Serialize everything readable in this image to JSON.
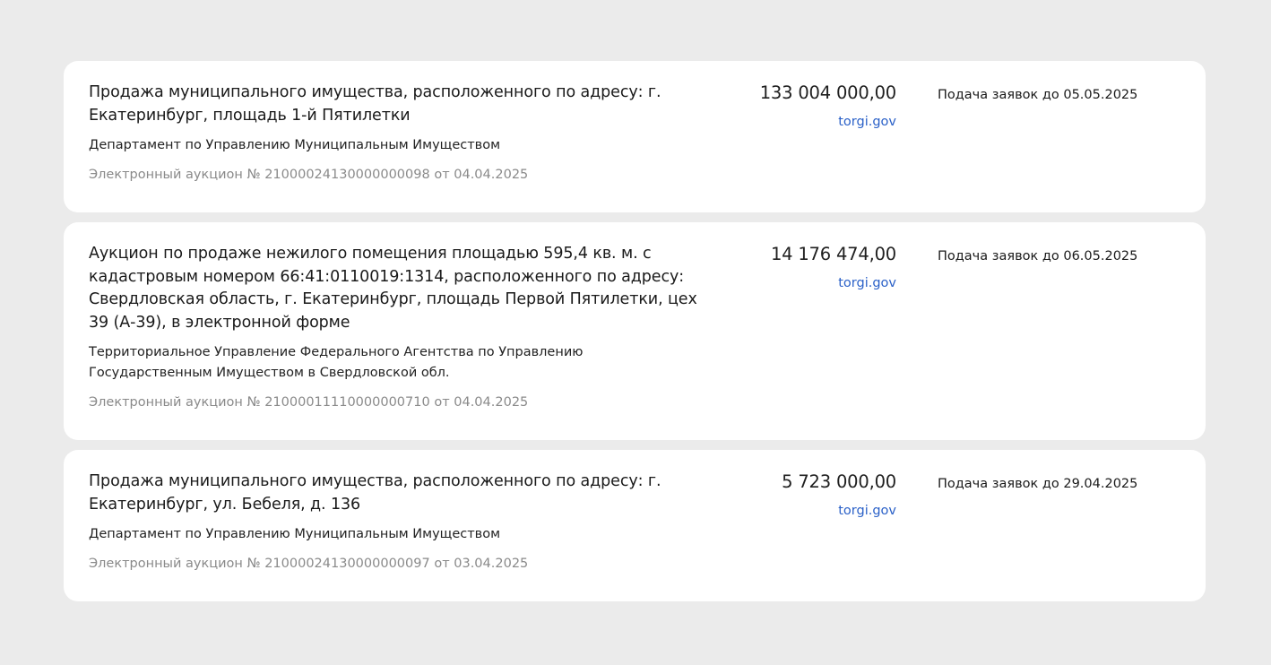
{
  "listings": [
    {
      "title": "Продажа муниципального имущества, расположенного по адресу: г. Екатеринбург, площадь 1-й Пятилетки",
      "organizer": "Департамент по Управлению Муниципальным Имуществом",
      "procedure": "Электронный аукцион № 21000024130000000098 от 04.04.2025",
      "price": "133 004 000,00",
      "source": "torgi.gov",
      "deadline": "Подача заявок до 05.05.2025"
    },
    {
      "title": "Аукцион по продаже нежилого помещения площадью 595,4 кв. м. с кадастровым номером 66:41:0110019:1314, расположенного по адресу: Свердловская область, г. Екатеринбург, площадь Первой Пятилетки, цех 39 (А-39), в электронной форме",
      "organizer": "Территориальное Управление Федерального Агентства по Управлению Государственным Имуществом в Свердловской обл.",
      "procedure": "Электронный аукцион № 21000011110000000710 от 04.04.2025",
      "price": "14 176 474,00",
      "source": "torgi.gov",
      "deadline": "Подача заявок до 06.05.2025"
    },
    {
      "title": "Продажа муниципального имущества, расположенного по адресу: г. Екатеринбург, ул. Бебеля, д. 136",
      "organizer": "Департамент по Управлению Муниципальным Имуществом",
      "procedure": "Электронный аукцион № 21000024130000000097 от 03.04.2025",
      "price": "5 723 000,00",
      "source": "torgi.gov",
      "deadline": "Подача заявок до 29.04.2025"
    }
  ],
  "colors": {
    "page_background": "#ebebeb",
    "card_background": "#ffffff",
    "link": "#2b61c8",
    "muted_text": "#8a8a8a"
  }
}
